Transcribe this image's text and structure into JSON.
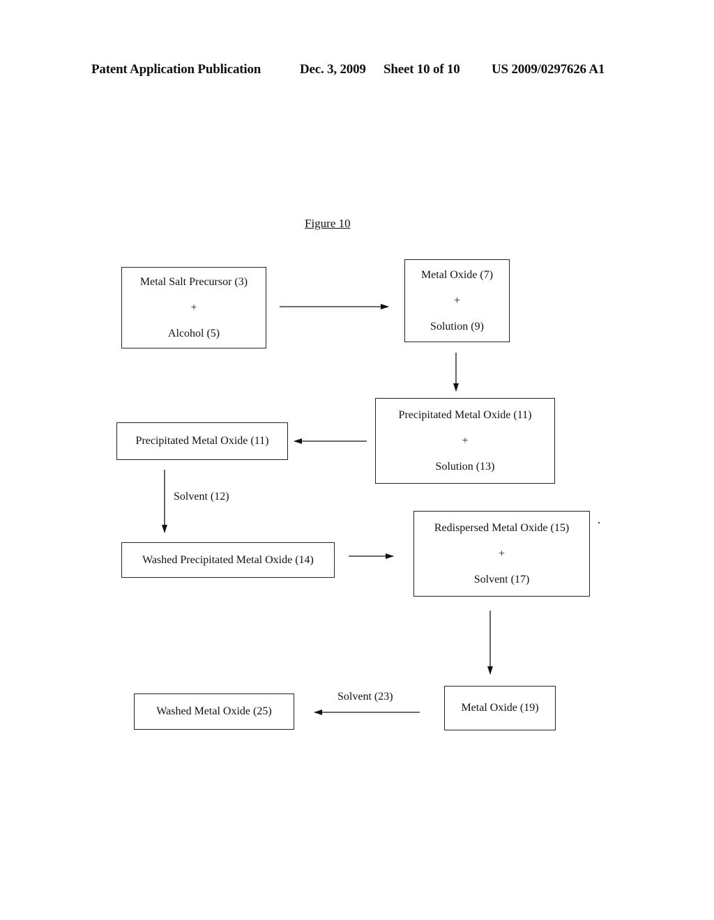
{
  "header": {
    "publication": "Patent Application Publication",
    "date": "Dec. 3, 2009",
    "sheet": "Sheet 10 of 10",
    "number": "US 2009/0297626 A1"
  },
  "figure": {
    "title": "Figure 10",
    "nodes": [
      {
        "id": "n1",
        "lines": [
          "Metal Salt Precursor (3)",
          "+",
          "Alcohol (5)"
        ]
      },
      {
        "id": "n2",
        "lines": [
          "Metal Oxide (7)",
          "+",
          "Solution (9)"
        ]
      },
      {
        "id": "n3",
        "lines": [
          "Precipitated Metal Oxide (11)",
          "+",
          "Solution (13)"
        ]
      },
      {
        "id": "n4",
        "lines": [
          "Precipitated Metal Oxide (11)"
        ]
      },
      {
        "id": "n5",
        "lines": [
          "Washed Precipitated Metal Oxide (14)"
        ]
      },
      {
        "id": "n6",
        "lines": [
          "Redispersed Metal Oxide (15)",
          "+",
          "Solvent (17)"
        ]
      },
      {
        "id": "n7",
        "lines": [
          "Metal Oxide (19)"
        ]
      },
      {
        "id": "n8",
        "lines": [
          "Washed Metal Oxide (25)"
        ]
      }
    ],
    "edges": [
      {
        "from": "n1",
        "to": "n2",
        "label": ""
      },
      {
        "from": "n2",
        "to": "n3",
        "label": ""
      },
      {
        "from": "n3",
        "to": "n4",
        "label": ""
      },
      {
        "from": "n4",
        "to": "n5",
        "label": "Solvent (12)"
      },
      {
        "from": "n5",
        "to": "n6",
        "label": ""
      },
      {
        "from": "n6",
        "to": "n7",
        "label": ""
      },
      {
        "from": "n7",
        "to": "n8",
        "label": "Solvent (23)"
      }
    ]
  }
}
